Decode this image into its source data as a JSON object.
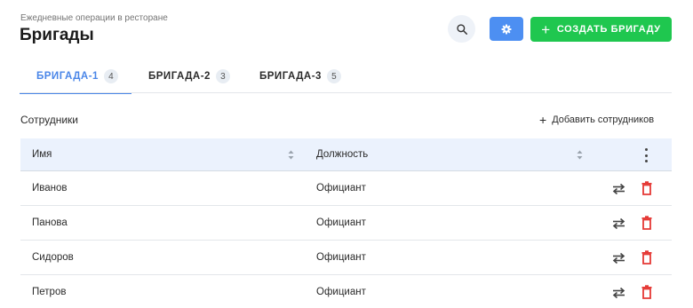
{
  "header": {
    "subtitle": "Ежедневные операции в ресторане",
    "title": "Бригады",
    "create_button_label": "СОЗДАТЬ БРИГАДУ"
  },
  "tabs": [
    {
      "label": "БРИГАДА-1",
      "count": "4",
      "active": true
    },
    {
      "label": "БРИГАДА-2",
      "count": "3",
      "active": false
    },
    {
      "label": "БРИГАДА-3",
      "count": "5",
      "active": false
    }
  ],
  "section": {
    "title": "Сотрудники",
    "add_label": "Добавить сотрудников"
  },
  "table": {
    "columns": [
      "Имя",
      "Должность"
    ],
    "rows": [
      {
        "name": "Иванов",
        "role": "Официант"
      },
      {
        "name": "Панова",
        "role": "Официант"
      },
      {
        "name": "Сидоров",
        "role": "Официант"
      },
      {
        "name": "Петров",
        "role": "Официант"
      }
    ]
  },
  "icons": {
    "search": "search-icon",
    "settings": "settings-icon",
    "add": "plus-icon",
    "sort": "sort-icon",
    "more": "more-vertical-icon",
    "swap": "swap-icon",
    "delete": "trash-icon"
  },
  "colors": {
    "accent": "#4a86e8",
    "primary_button": "#4d8ff2",
    "create_button": "#1fc74f",
    "danger": "#e53935",
    "table_header_bg": "#ebf2fd"
  }
}
